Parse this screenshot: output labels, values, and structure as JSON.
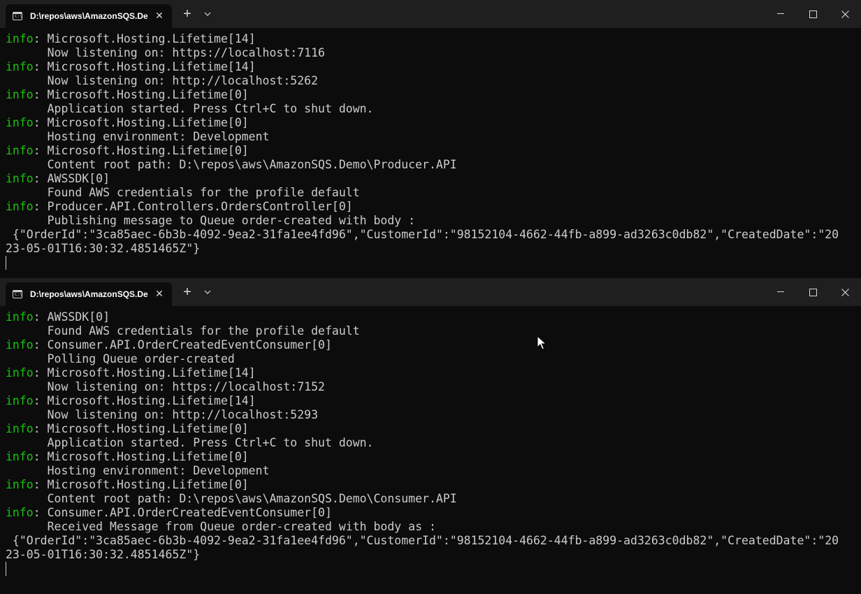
{
  "producer_window": {
    "tab_title": "D:\\repos\\aws\\AmazonSQS.De",
    "lines": [
      {
        "level": "info",
        "text": ": Microsoft.Hosting.Lifetime[14]"
      },
      {
        "level": "",
        "text": "      Now listening on: https://localhost:7116"
      },
      {
        "level": "info",
        "text": ": Microsoft.Hosting.Lifetime[14]"
      },
      {
        "level": "",
        "text": "      Now listening on: http://localhost:5262"
      },
      {
        "level": "info",
        "text": ": Microsoft.Hosting.Lifetime[0]"
      },
      {
        "level": "",
        "text": "      Application started. Press Ctrl+C to shut down."
      },
      {
        "level": "info",
        "text": ": Microsoft.Hosting.Lifetime[0]"
      },
      {
        "level": "",
        "text": "      Hosting environment: Development"
      },
      {
        "level": "info",
        "text": ": Microsoft.Hosting.Lifetime[0]"
      },
      {
        "level": "",
        "text": "      Content root path: D:\\repos\\aws\\AmazonSQS.Demo\\Producer.API"
      },
      {
        "level": "info",
        "text": ": AWSSDK[0]"
      },
      {
        "level": "",
        "text": "      Found AWS credentials for the profile default"
      },
      {
        "level": "info",
        "text": ": Producer.API.Controllers.OrdersController[0]"
      },
      {
        "level": "",
        "text": "      Publishing message to Queue order-created with body :"
      },
      {
        "level": "",
        "text": " {\"OrderId\":\"3ca85aec-6b3b-4092-9ea2-31fa1ee4fd96\",\"CustomerId\":\"98152104-4662-44fb-a899-ad3263c0db82\",\"CreatedDate\":\"20"
      },
      {
        "level": "",
        "text": "23-05-01T16:30:32.4851465Z\"}"
      }
    ]
  },
  "consumer_window": {
    "tab_title": "D:\\repos\\aws\\AmazonSQS.De",
    "lines": [
      {
        "level": "info",
        "text": ": AWSSDK[0]"
      },
      {
        "level": "",
        "text": "      Found AWS credentials for the profile default"
      },
      {
        "level": "info",
        "text": ": Consumer.API.OrderCreatedEventConsumer[0]"
      },
      {
        "level": "",
        "text": "      Polling Queue order-created"
      },
      {
        "level": "info",
        "text": ": Microsoft.Hosting.Lifetime[14]"
      },
      {
        "level": "",
        "text": "      Now listening on: https://localhost:7152"
      },
      {
        "level": "info",
        "text": ": Microsoft.Hosting.Lifetime[14]"
      },
      {
        "level": "",
        "text": "      Now listening on: http://localhost:5293"
      },
      {
        "level": "info",
        "text": ": Microsoft.Hosting.Lifetime[0]"
      },
      {
        "level": "",
        "text": "      Application started. Press Ctrl+C to shut down."
      },
      {
        "level": "info",
        "text": ": Microsoft.Hosting.Lifetime[0]"
      },
      {
        "level": "",
        "text": "      Hosting environment: Development"
      },
      {
        "level": "info",
        "text": ": Microsoft.Hosting.Lifetime[0]"
      },
      {
        "level": "",
        "text": "      Content root path: D:\\repos\\aws\\AmazonSQS.Demo\\Consumer.API"
      },
      {
        "level": "info",
        "text": ": Consumer.API.OrderCreatedEventConsumer[0]"
      },
      {
        "level": "",
        "text": "      Received Message from Queue order-created with body as :"
      },
      {
        "level": "",
        "text": " {\"OrderId\":\"3ca85aec-6b3b-4092-9ea2-31fa1ee4fd96\",\"CustomerId\":\"98152104-4662-44fb-a899-ad3263c0db82\",\"CreatedDate\":\"20"
      },
      {
        "level": "",
        "text": "23-05-01T16:30:32.4851465Z\"}"
      }
    ]
  },
  "icons": {
    "tab_icon": "terminal-icon",
    "close": "close-icon",
    "new_tab": "plus-icon",
    "dropdown": "chevron-down-icon",
    "minimize": "minimize-icon",
    "maximize": "maximize-icon",
    "window_close": "window-close-icon",
    "pointer": "mouse-pointer-icon"
  },
  "colors": {
    "background": "#0c0c0c",
    "titlebar": "#1f1f1f",
    "text": "#cccccc",
    "info": "#16c60c"
  }
}
